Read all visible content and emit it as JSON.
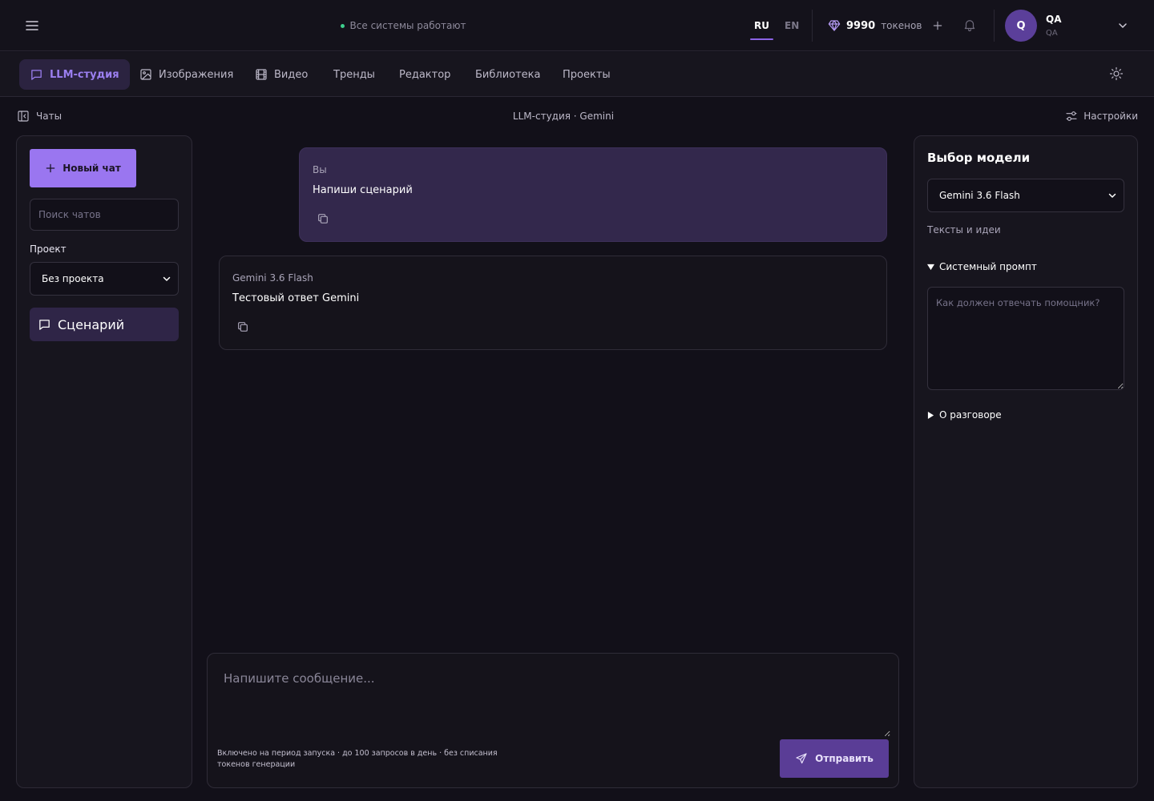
{
  "topbar": {
    "status_text": "Все системы работают",
    "lang_ru": "RU",
    "lang_en": "EN",
    "tokens_count": "9990",
    "tokens_label": "токенов",
    "user_initial": "Q",
    "user_name": "QA",
    "user_sub": "QA"
  },
  "nav": {
    "items": [
      {
        "label": "LLM-студия",
        "icon": "chat-bubble-icon",
        "active": true
      },
      {
        "label": "Изображения",
        "icon": "image-icon"
      },
      {
        "label": "Видео",
        "icon": "film-icon"
      },
      {
        "label": "Тренды"
      },
      {
        "label": "Редактор"
      },
      {
        "label": "Библиотека"
      },
      {
        "label": "Проекты"
      }
    ]
  },
  "subheader": {
    "chats_label": "Чаты",
    "breadcrumb": "LLM-студия · Gemini",
    "settings_label": "Настройки"
  },
  "sidebar": {
    "new_chat_label": "Новый чат",
    "search_placeholder": "Поиск чатов",
    "project_label": "Проект",
    "project_value": "Без проекта",
    "chats": [
      {
        "title": "Сценарий",
        "active": true
      }
    ]
  },
  "messages": [
    {
      "author": "Вы",
      "text": "Напиши сценарий",
      "role": "user"
    },
    {
      "author": "Gemini 3.6 Flash",
      "text": "Тестовый ответ Gemini",
      "role": "assistant"
    }
  ],
  "composer": {
    "placeholder": "Напишите сообщение...",
    "note": "Включено на период запуска · до 100 запросов в день · без списания токенов генерации",
    "send_label": "Отправить"
  },
  "model_panel": {
    "title": "Выбор модели",
    "selected_model": "Gemini 3.6 Flash",
    "model_description": "Тексты и идеи",
    "system_prompt_label": "Системный промпт",
    "system_prompt_placeholder": "Как должен отвечать помощник?",
    "about_label": "О разговоре"
  },
  "colors": {
    "accent": "#9a76f0",
    "background": "#121019",
    "status_ok": "#3ecf8e"
  }
}
